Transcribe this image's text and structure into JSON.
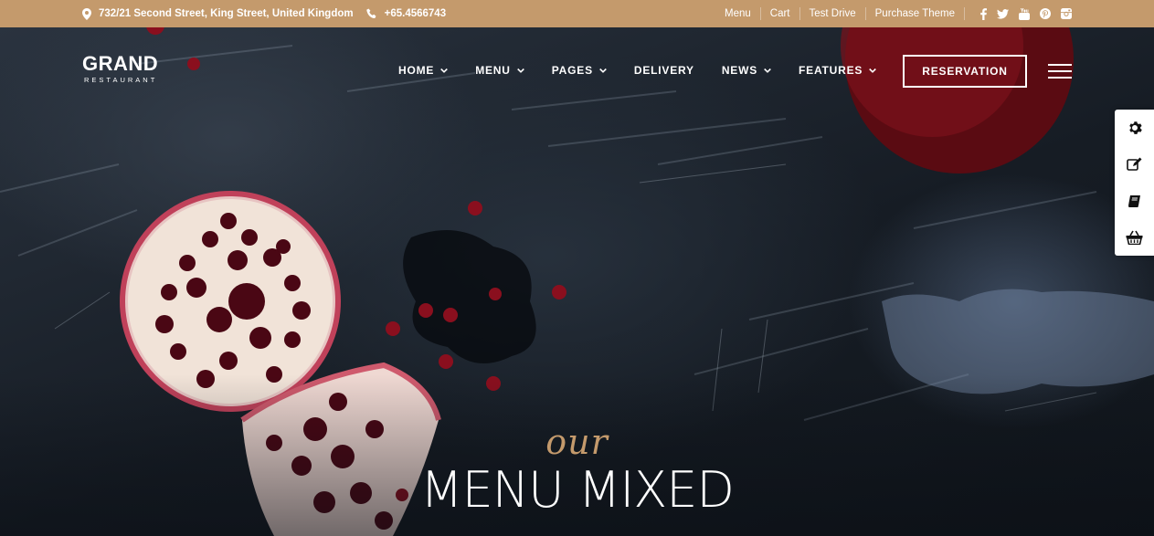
{
  "topbar": {
    "address": "732/21 Second Street, King Street, United Kingdom",
    "phone": "+65.4566743",
    "links": [
      "Menu",
      "Cart",
      "Test Drive",
      "Purchase Theme"
    ],
    "social_icons": [
      "facebook-icon",
      "twitter-icon",
      "youtube-icon",
      "pinterest-icon",
      "instagram-icon"
    ]
  },
  "header": {
    "logo_brand": "GRAND",
    "logo_sub": "RESTAURANT",
    "nav": [
      {
        "label": "HOME",
        "dropdown": true
      },
      {
        "label": "MENU",
        "dropdown": true
      },
      {
        "label": "PAGES",
        "dropdown": true
      },
      {
        "label": "DELIVERY",
        "dropdown": false
      },
      {
        "label": "NEWS",
        "dropdown": true
      },
      {
        "label": "FEATURES",
        "dropdown": true
      }
    ],
    "reservation_label": "RESERVATION"
  },
  "dock": {
    "icons": [
      "gear-icon",
      "edit-icon",
      "book-icon",
      "basket-icon"
    ]
  },
  "hero": {
    "script_text": "our",
    "title": "MENU MIXED"
  },
  "colors": {
    "accent": "#c49a6c",
    "background": "#1b222b",
    "text": "#ffffff"
  }
}
